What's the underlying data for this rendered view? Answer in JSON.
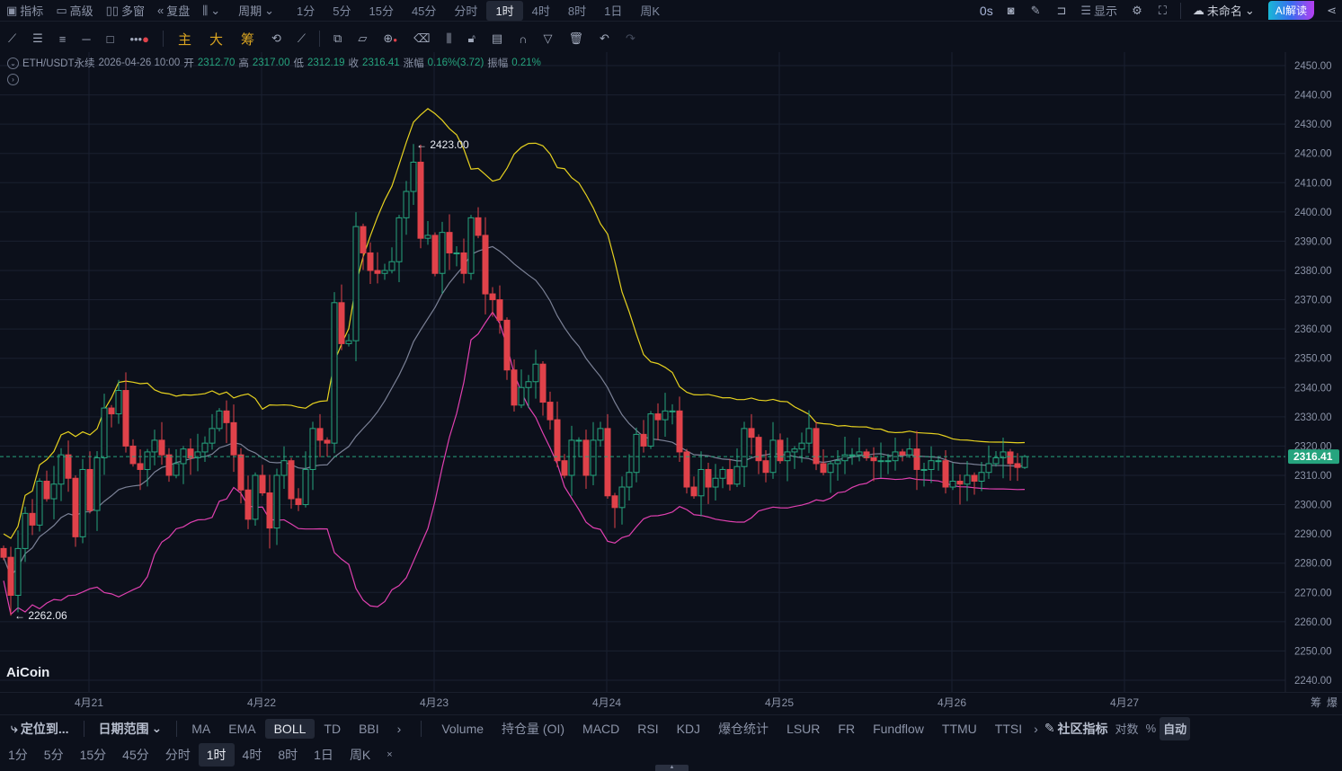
{
  "top": {
    "left": [
      {
        "icon": "chart-indicator-icon",
        "g": "▣",
        "label": "指标"
      },
      {
        "icon": "advanced-icon",
        "g": "▭",
        "label": "高级"
      },
      {
        "icon": "multi-window-icon",
        "g": "▯▯",
        "label": "多窗"
      },
      {
        "icon": "replay-icon",
        "g": "«",
        "label": "复盘"
      }
    ],
    "chart_type_icon": "candle-type-icon",
    "period_label": "周期",
    "periods": [
      "1分",
      "5分",
      "15分",
      "45分",
      "分时",
      "1时",
      "4时",
      "8时",
      "1日",
      "周K"
    ],
    "active_period": "1时",
    "timer": "0s",
    "display_label": "显示",
    "layout_name": "未命名",
    "ai_label": "AI解读"
  },
  "toolbar": {
    "gold": [
      "主",
      "大",
      "筹"
    ]
  },
  "info": {
    "symbol": "ETH/USDT永续",
    "time": "2026-04-26 10:00",
    "open_label": "开",
    "open": "2312.70",
    "high_label": "高",
    "high": "2317.00",
    "low_label": "低",
    "low": "2312.19",
    "close_label": "收",
    "close": "2316.41",
    "change_label": "涨幅",
    "change": "0.16%(3.72)",
    "amp_label": "振幅",
    "amp": "0.21%"
  },
  "chart_data": {
    "type": "candlestick",
    "interval": "1h",
    "ylim": [
      2240,
      2450
    ],
    "yticks": [
      2450,
      2440,
      2430,
      2420,
      2410,
      2400,
      2390,
      2380,
      2370,
      2360,
      2350,
      2340,
      2330,
      2320,
      2310,
      2300,
      2290,
      2280,
      2270,
      2260,
      2250,
      2240
    ],
    "dates": [
      "4月21",
      "4月22",
      "4月23",
      "4月24",
      "4月25",
      "4月26",
      "4月27"
    ],
    "closes": [
      2282,
      2269,
      2285,
      2297,
      2293,
      2308,
      2302,
      2307,
      2317,
      2309,
      2289,
      2312,
      2298,
      2316,
      2333,
      2331,
      2339,
      2320,
      2314,
      2312,
      2318,
      2322,
      2317,
      2310,
      2314,
      2319,
      2316,
      2318,
      2321,
      2326,
      2332,
      2328,
      2317,
      2305,
      2295,
      2310,
      2304,
      2292,
      2310,
      2315,
      2302,
      2300,
      2312,
      2326,
      2322,
      2321,
      2369,
      2355,
      2356,
      2395,
      2386,
      2380,
      2379,
      2380,
      2383,
      2398,
      2407,
      2417,
      2391,
      2392,
      2379,
      2393,
      2386,
      2386,
      2379,
      2398,
      2392,
      2372,
      2370,
      2363,
      2346,
      2334,
      2340,
      2342,
      2348,
      2335,
      2329,
      2315,
      2310,
      2322,
      2322,
      2310,
      2322,
      2326,
      2303,
      2299,
      2306,
      2311,
      2324,
      2320,
      2331,
      2329,
      2332,
      2332,
      2318,
      2306,
      2303,
      2312,
      2306,
      2309,
      2312,
      2307,
      2313,
      2326,
      2323,
      2315,
      2311,
      2322,
      2315,
      2318,
      2319,
      2321,
      2326,
      2314,
      2311,
      2314,
      2315,
      2317,
      2317,
      2318,
      2316,
      2315,
      2315,
      2315,
      2318,
      2317,
      2319,
      2312,
      2312,
      2315,
      2315,
      2306,
      2308,
      2307,
      2310,
      2308,
      2311,
      2314,
      2316,
      2318,
      2314,
      2312.7,
      2316.41
    ],
    "first_open": 2285,
    "max_high": {
      "value": 2423.0,
      "label": "2423.00",
      "index": 58
    },
    "min_low": {
      "value": 2262.06,
      "label": "2262.06",
      "index": 1
    },
    "last_price": "2316.41",
    "boll": {
      "period": 20,
      "mult": 2,
      "colors": {
        "upper": "#e6d11f",
        "mid": "#7b8196",
        "lower": "#e040b0"
      }
    },
    "colors": {
      "up": "#26a47e",
      "down": "#e0424a"
    }
  },
  "axis_right": [
    "筹",
    "爆"
  ],
  "indicators": {
    "locate": "定位到...",
    "date_range": "日期范围",
    "main": [
      "MA",
      "EMA",
      "BOLL",
      "TD",
      "BBI"
    ],
    "active": "BOLL",
    "sub": [
      "Volume",
      "持仓量 (OI)",
      "MACD",
      "RSI",
      "KDJ",
      "爆仓统计",
      "LSUR",
      "FR",
      "Fundflow",
      "TTMU",
      "TTSI"
    ],
    "community": "社区指标",
    "log": "对数",
    "percent": "%",
    "auto": "自动"
  },
  "quick_periods": [
    "1分",
    "5分",
    "15分",
    "45分",
    "分时",
    "1时",
    "4时",
    "8时",
    "1日",
    "周K"
  ],
  "logo": "AiCoin"
}
